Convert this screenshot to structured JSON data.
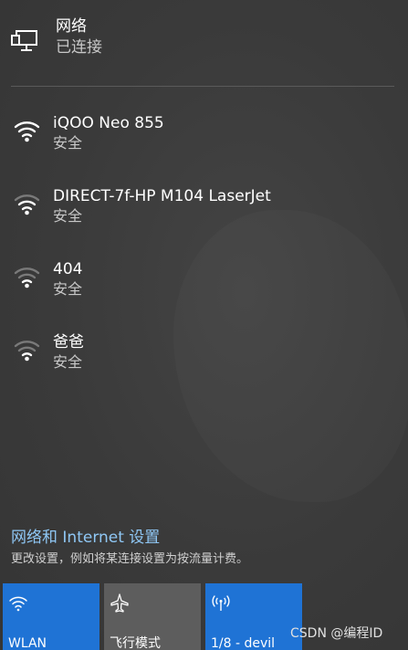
{
  "current_network": {
    "title": "网络",
    "status": "已连接",
    "icon": "monitor-network-icon"
  },
  "wifi_networks": [
    {
      "name": "iQOO Neo 855",
      "security": "安全",
      "icon": "wifi-secure-icon"
    },
    {
      "name": "DIRECT-7f-HP M104 LaserJet",
      "security": "安全",
      "icon": "wifi-secure-icon"
    },
    {
      "name": "404",
      "security": "安全",
      "icon": "wifi-secure-icon"
    },
    {
      "name": "爸爸",
      "security": "安全",
      "icon": "wifi-secure-icon"
    }
  ],
  "settings": {
    "link_label": "网络和 Internet 设置",
    "description": "更改设置，例如将某连接设置为按流量计费。"
  },
  "quick_actions": {
    "wlan_label": "WLAN",
    "airplane_label": "飞行模式",
    "hotspot_label": "1/8 - devil"
  },
  "watermark": "CSDN @编程ID",
  "colors": {
    "accent": "#1f73d5",
    "link": "#8fc7f5",
    "tile_inactive": "#5d5d5d",
    "background": "#3b3b3b"
  }
}
